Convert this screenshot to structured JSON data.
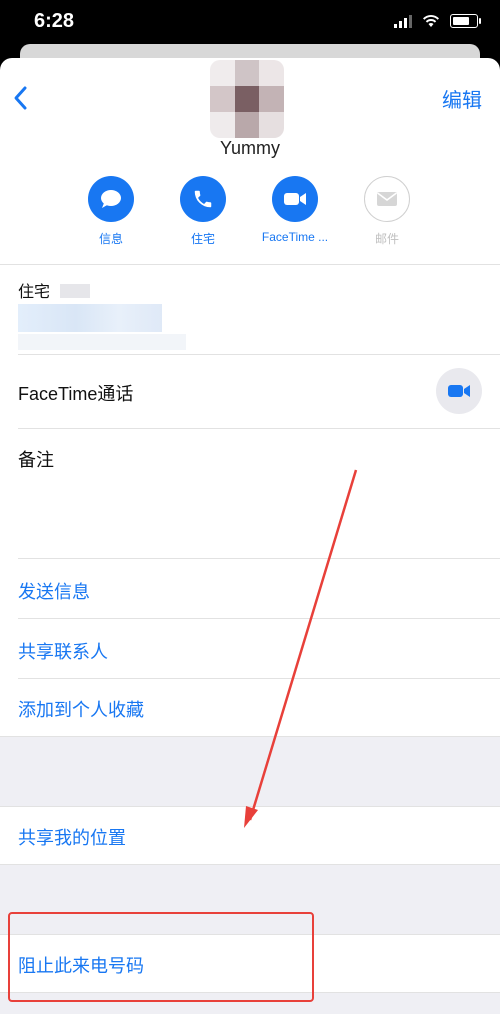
{
  "status_bar": {
    "time": "6:28"
  },
  "header": {
    "edit_label": "编辑"
  },
  "contact": {
    "name": "Yummy"
  },
  "actions": [
    {
      "label": "信息",
      "icon": "message-icon",
      "enabled": true
    },
    {
      "label": "住宅",
      "icon": "phone-icon",
      "enabled": true
    },
    {
      "label": "FaceTime ...",
      "icon": "video-icon",
      "enabled": true
    },
    {
      "label": "邮件",
      "icon": "mail-icon",
      "enabled": false
    }
  ],
  "phone_field": {
    "label": "住宅"
  },
  "facetime": {
    "label": "FaceTime通话"
  },
  "notes": {
    "label": "备注"
  },
  "links": {
    "send_message": "发送信息",
    "share_contact": "共享联系人",
    "add_favorite": "添加到个人收藏",
    "share_location": "共享我的位置",
    "block_caller": "阻止此来电号码"
  },
  "colors": {
    "accent": "#1877f2",
    "annotation": "#e8403a",
    "group_bg": "#efeff4"
  }
}
